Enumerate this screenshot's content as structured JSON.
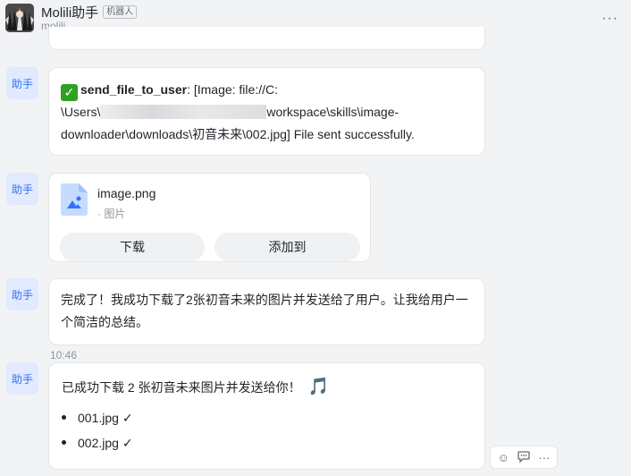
{
  "header": {
    "title": "Molili助手",
    "bot_tag": "机器人",
    "subtitle": "molili",
    "more_icon": "more-horizontal-icon"
  },
  "helper_avatar_label": "助手",
  "message1": {
    "tool_name": "send_file_to_user",
    "line1_rest": ": [Image: file://C:",
    "line2_prefix": "\\Users\\",
    "line2_suffix": "workspace\\skills\\image-",
    "line3": "downloader\\downloads\\初音未来\\002.jpg] File sent successfully."
  },
  "message2": {
    "file_name": "image.png",
    "file_meta": "· 图片",
    "download_label": "下载",
    "add_to_label": "添加到"
  },
  "message3": {
    "line1": "完成了！我成功下载了2张初音未来的图片并发送给了用户。让我给用户一",
    "line2": "个简洁的总结。"
  },
  "timestamp": "10:46",
  "message4": {
    "summary": "已成功下载 2 张初音未来图片并发送给你！",
    "emoji": "🎵",
    "items": [
      "001.jpg ✓",
      "002.jpg ✓"
    ]
  },
  "reactions": {
    "emoji_icon": "☺",
    "comment_icon": "💬",
    "more_icon": "···"
  },
  "colors": {
    "accent": "#3370ff",
    "success": "#2ea121",
    "background": "#f2f3f5"
  }
}
